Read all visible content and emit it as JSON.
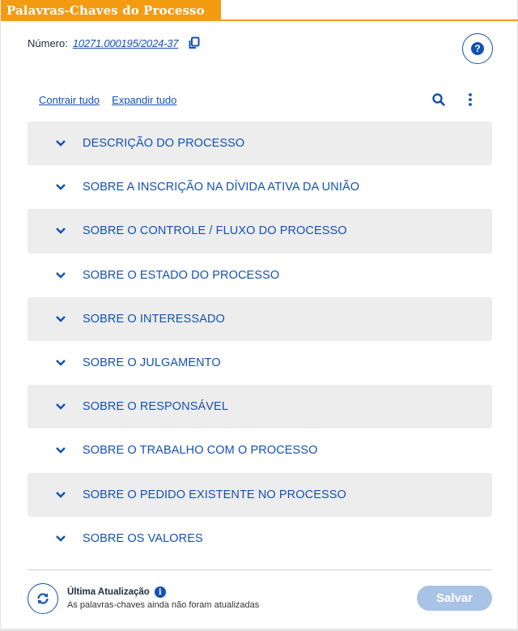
{
  "window": {
    "title": "Palavras-Chaves do Processo"
  },
  "processo": {
    "numero_label": "Número:",
    "numero_value": "10271.000195/2024-37"
  },
  "toolbar": {
    "collapse_all": "Contrair tudo",
    "expand_all": "Expandir tudo"
  },
  "sections": [
    {
      "label": "DESCRIÇÃO DO PROCESSO"
    },
    {
      "label": "SOBRE A INSCRIÇÃO NA DÍVIDA ATIVA DA UNIÃO"
    },
    {
      "label": "SOBRE O CONTROLE / FLUXO DO PROCESSO"
    },
    {
      "label": "SOBRE O ESTADO DO PROCESSO"
    },
    {
      "label": "SOBRE O INTERESSADO"
    },
    {
      "label": "SOBRE O JULGAMENTO"
    },
    {
      "label": "SOBRE O RESPONSÁVEL"
    },
    {
      "label": "SOBRE O TRABALHO COM O PROCESSO"
    },
    {
      "label": "SOBRE O PEDIDO EXISTENTE NO PROCESSO"
    },
    {
      "label": "SOBRE OS VALORES"
    }
  ],
  "footer": {
    "last_update_label": "Última Atualização",
    "status_text": "As palavras-chaves ainda não foram atualizadas",
    "save_label": "Salvar"
  },
  "icons": {
    "help": "help-icon",
    "copy": "copy-icon",
    "search": "search-icon",
    "more": "more-vertical-icon",
    "chevron": "chevron-down-icon",
    "refresh": "refresh-icon",
    "info": "info-icon"
  },
  "colors": {
    "accent": "#f39c12",
    "primary": "#1351b4",
    "row_shade": "#ededed",
    "save_disabled": "#a9c3e6"
  }
}
